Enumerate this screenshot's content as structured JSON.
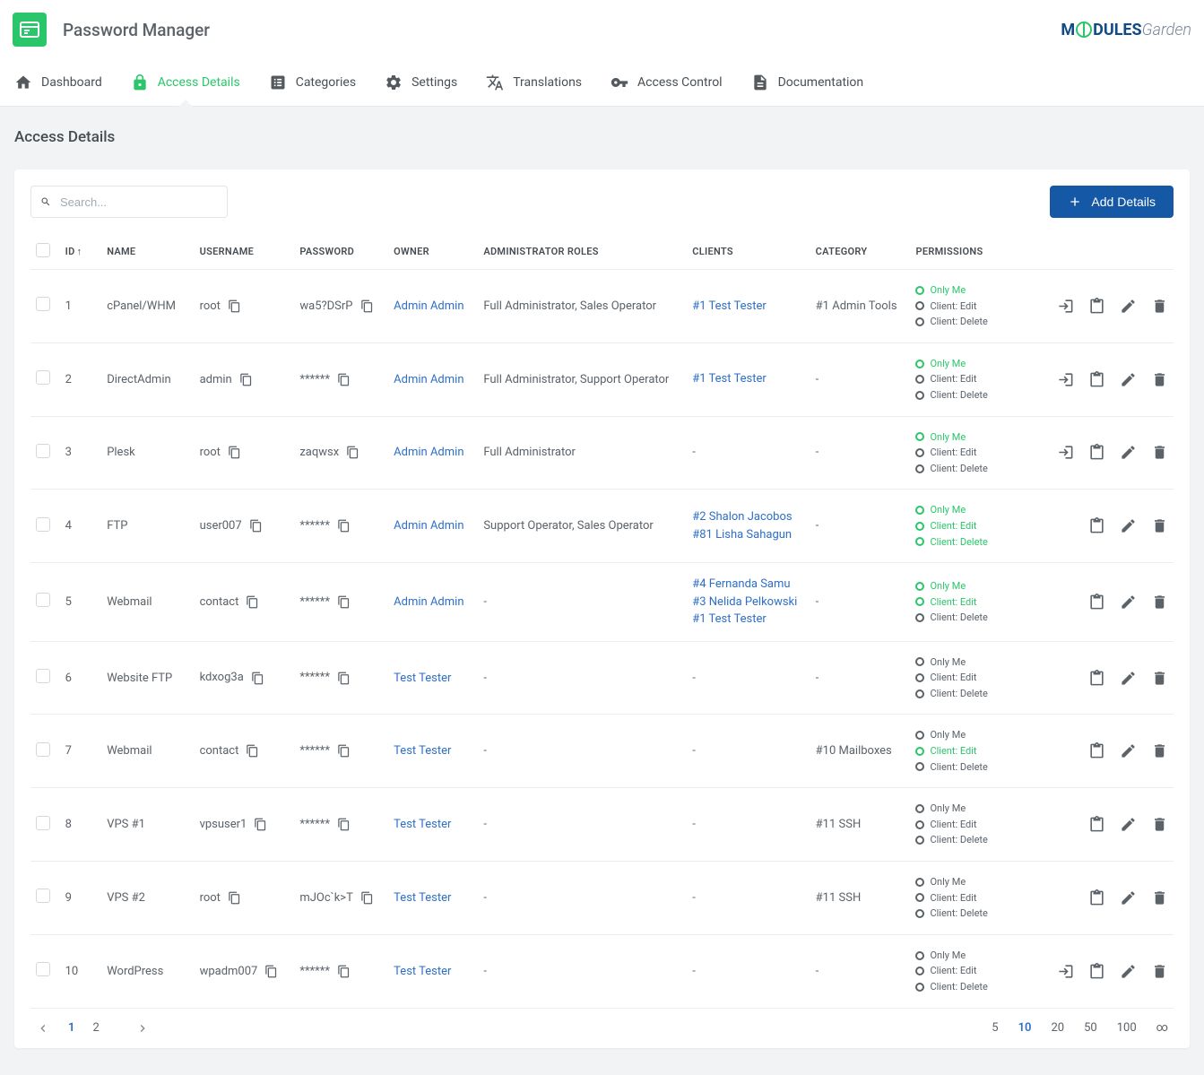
{
  "app_title": "Password Manager",
  "brand": {
    "left": "M",
    "right": "DULES",
    "suffix": "Garden"
  },
  "nav": {
    "dashboard": "Dashboard",
    "access_details": "Access Details",
    "categories": "Categories",
    "settings": "Settings",
    "translations": "Translations",
    "access_control": "Access Control",
    "documentation": "Documentation"
  },
  "page_title": "Access Details",
  "search_placeholder": "Search...",
  "add_button": "Add Details",
  "columns": {
    "id": "ID",
    "name": "NAME",
    "username": "USERNAME",
    "password": "PASSWORD",
    "owner": "OWNER",
    "admin_roles": "ADMINISTRATOR ROLES",
    "clients": "CLIENTS",
    "category": "CATEGORY",
    "permissions": "PERMISSIONS"
  },
  "rows": [
    {
      "id": "1",
      "name": "cPanel/WHM",
      "username": "root",
      "password": "wa5?DSrP",
      "owner": "Admin Admin",
      "roles": "Full Administrator, Sales Operator",
      "clients": [
        "#1 Test Tester"
      ],
      "category": "#1 Admin Tools",
      "perm": [
        {
          "label": "Only Me",
          "green": true
        },
        {
          "label": "Client: Edit",
          "green": false
        },
        {
          "label": "Client: Delete",
          "green": false
        }
      ],
      "has_login": true
    },
    {
      "id": "2",
      "name": "DirectAdmin",
      "username": "admin",
      "password": "******",
      "owner": "Admin Admin",
      "roles": "Full Administrator, Support Operator",
      "clients": [
        "#1 Test Tester"
      ],
      "category": "-",
      "perm": [
        {
          "label": "Only Me",
          "green": true
        },
        {
          "label": "Client: Edit",
          "green": false
        },
        {
          "label": "Client: Delete",
          "green": false
        }
      ],
      "has_login": true
    },
    {
      "id": "3",
      "name": "Plesk",
      "username": "root",
      "password": "zaqwsx",
      "owner": "Admin Admin",
      "roles": "Full Administrator",
      "clients": [],
      "category": "-",
      "perm": [
        {
          "label": "Only Me",
          "green": true
        },
        {
          "label": "Client: Edit",
          "green": false
        },
        {
          "label": "Client: Delete",
          "green": false
        }
      ],
      "has_login": true
    },
    {
      "id": "4",
      "name": "FTP",
      "username": "user007",
      "password": "******",
      "owner": "Admin Admin",
      "roles": "Support Operator, Sales Operator",
      "clients": [
        "#2 Shalon Jacobos",
        "#81 Lisha Sahagun"
      ],
      "category": "-",
      "perm": [
        {
          "label": "Only Me",
          "green": true
        },
        {
          "label": "Client: Edit",
          "green": true
        },
        {
          "label": "Client: Delete",
          "green": true
        }
      ],
      "has_login": false
    },
    {
      "id": "5",
      "name": "Webmail",
      "username": "contact",
      "password": "******",
      "owner": "Admin Admin",
      "roles": "-",
      "clients": [
        "#4 Fernanda Samu",
        "#3 Nelida Pelkowski",
        "#1 Test Tester"
      ],
      "category": "-",
      "perm": [
        {
          "label": "Only Me",
          "green": true
        },
        {
          "label": "Client: Edit",
          "green": true
        },
        {
          "label": "Client: Delete",
          "green": false
        }
      ],
      "has_login": false
    },
    {
      "id": "6",
      "name": "Website FTP",
      "username": "kdxog3a",
      "password": "******",
      "owner": "Test Tester",
      "roles": "-",
      "clients": [],
      "category": "-",
      "perm": [
        {
          "label": "Only Me",
          "green": false
        },
        {
          "label": "Client: Edit",
          "green": false
        },
        {
          "label": "Client: Delete",
          "green": false
        }
      ],
      "has_login": false
    },
    {
      "id": "7",
      "name": "Webmail",
      "username": "contact",
      "password": "******",
      "owner": "Test Tester",
      "roles": "-",
      "clients": [],
      "category": "#10 Mailboxes",
      "perm": [
        {
          "label": "Only Me",
          "green": false
        },
        {
          "label": "Client: Edit",
          "green": true
        },
        {
          "label": "Client: Delete",
          "green": false
        }
      ],
      "has_login": false
    },
    {
      "id": "8",
      "name": "VPS #1",
      "username": "vpsuser1",
      "password": "******",
      "owner": "Test Tester",
      "roles": "-",
      "clients": [],
      "category": "#11 SSH",
      "perm": [
        {
          "label": "Only Me",
          "green": false
        },
        {
          "label": "Client: Edit",
          "green": false
        },
        {
          "label": "Client: Delete",
          "green": false
        }
      ],
      "has_login": false
    },
    {
      "id": "9",
      "name": "VPS #2",
      "username": "root",
      "password": "mJOc`k>T",
      "owner": "Test Tester",
      "roles": "-",
      "clients": [],
      "category": "#11 SSH",
      "perm": [
        {
          "label": "Only Me",
          "green": false
        },
        {
          "label": "Client: Edit",
          "green": false
        },
        {
          "label": "Client: Delete",
          "green": false
        }
      ],
      "has_login": false
    },
    {
      "id": "10",
      "name": "WordPress",
      "username": "wpadm007",
      "password": "******",
      "owner": "Test Tester",
      "roles": "-",
      "clients": [],
      "category": "-",
      "perm": [
        {
          "label": "Only Me",
          "green": false
        },
        {
          "label": "Client: Edit",
          "green": false
        },
        {
          "label": "Client: Delete",
          "green": false
        }
      ],
      "has_login": true
    }
  ],
  "pager": {
    "pages": [
      "1",
      "2"
    ],
    "active": "1"
  },
  "per_page": {
    "options": [
      "5",
      "10",
      "20",
      "50",
      "100",
      "∞"
    ],
    "active": "10"
  }
}
